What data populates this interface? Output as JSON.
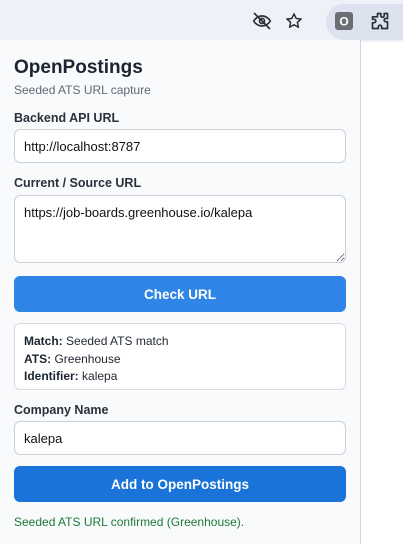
{
  "browser_toolbar": {
    "icons": [
      "eye-off-icon",
      "star-icon",
      "extension-o-icon",
      "puzzle-icon"
    ],
    "extension_badge_letter": "O"
  },
  "popup": {
    "title": "OpenPostings",
    "subtitle": "Seeded ATS URL capture",
    "backend_api": {
      "label": "Backend API URL",
      "value": "http://localhost:8787"
    },
    "source_url": {
      "label": "Current / Source URL",
      "value": "https://job-boards.greenhouse.io/kalepa"
    },
    "check_button_label": "Check URL",
    "result": {
      "match_label": "Match:",
      "match_value": "Seeded ATS match",
      "ats_label": "ATS:",
      "ats_value": "Greenhouse",
      "identifier_label": "Identifier:",
      "identifier_value": "kalepa"
    },
    "company_name": {
      "label": "Company Name",
      "value": "kalepa"
    },
    "add_button_label": "Add to OpenPostings",
    "status_message": "Seeded ATS URL confirmed (Greenhouse)."
  },
  "colors": {
    "check_button": "#2f86e6",
    "add_button": "#1a73d9",
    "status_success": "#1f7a34"
  }
}
